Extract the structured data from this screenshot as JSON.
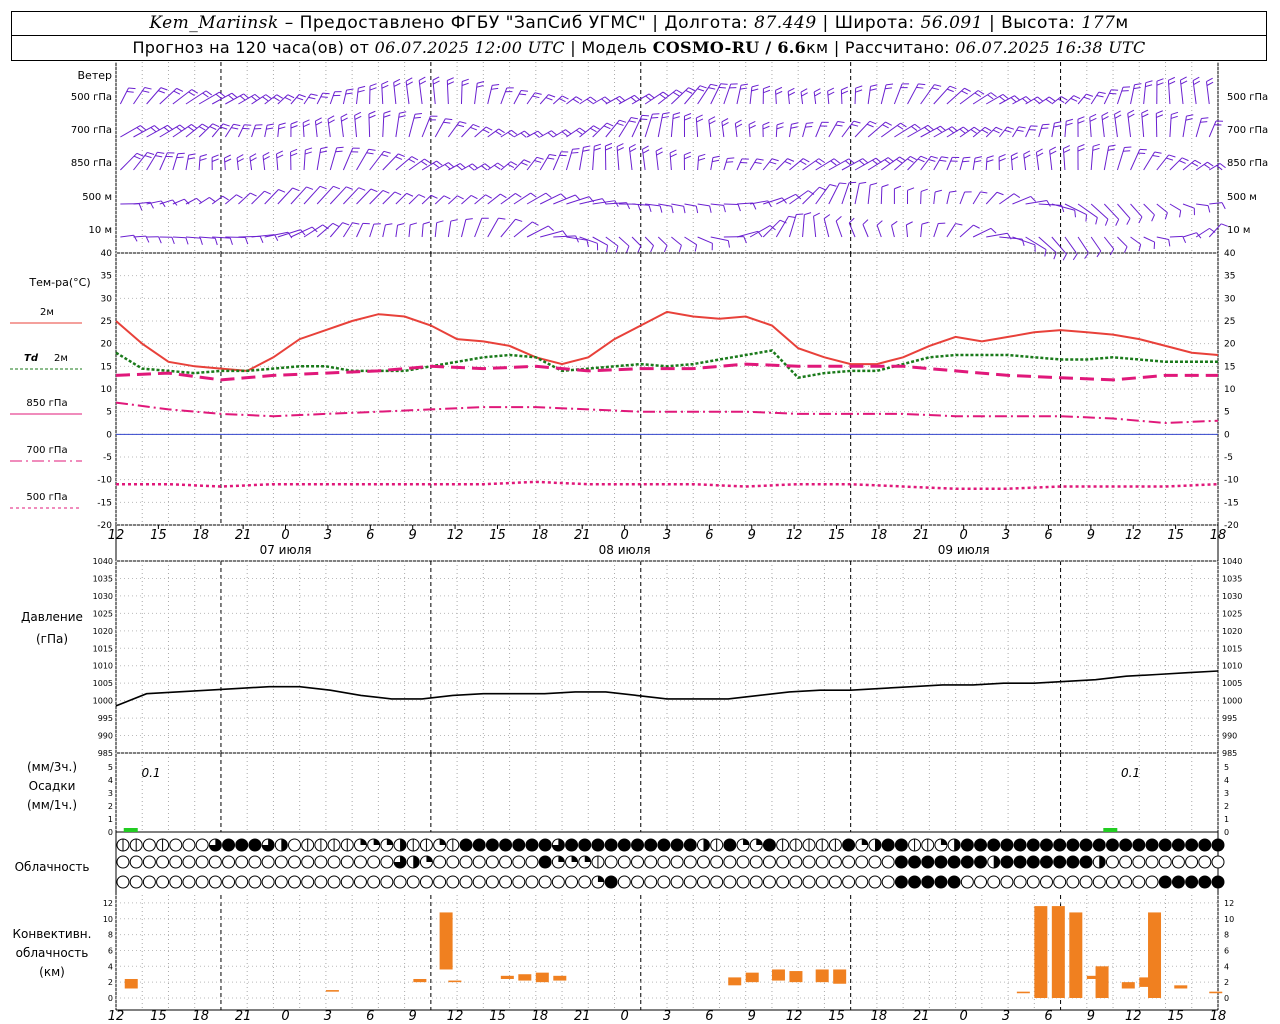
{
  "header": {
    "station": "Kem_Mariinsk",
    "provider": " – Предоставлено ФГБУ \"ЗапСиб УГМС\" | Долгота: ",
    "lon": "87.449",
    "lat_label": " | Широта: ",
    "lat": "56.091",
    "alt_label": " | Высота: ",
    "alt": "177",
    "alt_unit": "м",
    "forecast_label": "Прогноз на 120 часа(ов) от ",
    "forecast_date": "06.07.2025 12:00 UTC",
    "model_label": "  | Модель ",
    "model": "COSMO-RU / 6.6",
    "model_unit": "км",
    "calc_label": " | Рассчитано: ",
    "calc_date": "06.07.2025 16:38 UTC"
  },
  "labels": {
    "wind": "Ветер",
    "levels": [
      "500 гПа",
      "700 гПа",
      "850 гПа",
      "500 м",
      "10  м"
    ],
    "temp": "Тем-ра(°C)",
    "t2m": "2м",
    "td": "Td",
    "td2m": "2м",
    "t850": "850 гПа",
    "t700": "700 гПа",
    "t500": "500 гПа",
    "pressure": "Давление",
    "pressure_unit": "(гПа)",
    "precip_u1": "(мм/3ч.)",
    "precip": "Осадки",
    "precip_u2": "(мм/1ч.)",
    "cloud": "Облачность",
    "conv1": "Конвективн.",
    "conv2": "облачность",
    "conv3": "(км)"
  },
  "colors": {
    "t2m": "#e8413a",
    "td": "#1a7a1a",
    "t850": "#e0187a",
    "t700": "#e0187a",
    "t500": "#e0187a",
    "wind": "#6a1fd0",
    "zero": "#3344cc",
    "pressure": "#000000",
    "precip": "#22cc22",
    "conv": "#f08020"
  },
  "chart_data": {
    "type": "line",
    "time_step_hours": 3,
    "x_ticks": [
      "12",
      "15",
      "18",
      "21",
      "0",
      "3",
      "6",
      "9",
      "12",
      "15",
      "18",
      "21",
      "0",
      "3",
      "6",
      "9",
      "12",
      "15",
      "18",
      "21",
      "0",
      "3",
      "6",
      "9",
      "12",
      "15",
      "18"
    ],
    "date_labels": [
      {
        "text": "07 июля",
        "tick": 4
      },
      {
        "text": "08 июля",
        "tick": 12
      },
      {
        "text": "09 июля",
        "tick": 20
      }
    ],
    "temp_ylim": [
      -20,
      40
    ],
    "temp_yticks": [
      "40",
      "35",
      "30",
      "25",
      "20",
      "15",
      "10",
      "5",
      "0",
      "-5",
      "-10",
      "-15",
      "-20"
    ],
    "series": [
      {
        "name": "2м",
        "x": [
          0,
          3,
          6,
          9,
          12,
          15,
          18,
          21,
          24,
          27,
          30,
          33,
          36,
          39,
          42,
          45,
          48,
          51,
          54,
          57,
          60,
          63,
          66,
          69,
          72,
          75,
          78,
          81,
          84,
          87,
          90,
          93,
          96,
          99,
          102,
          105,
          108,
          111,
          114,
          117,
          120,
          123,
          126
        ],
        "values": [
          25,
          20,
          16,
          15,
          14.5,
          14,
          17,
          21,
          23,
          25,
          26.5,
          26,
          24,
          21,
          20.5,
          19.5,
          17,
          15.5,
          17,
          21,
          24,
          27,
          26,
          25.5,
          26,
          24,
          19,
          17,
          15.5,
          15.5,
          17,
          19.5,
          21.5,
          20.5,
          21.5,
          22.5,
          23,
          22.5,
          22,
          21,
          19.5,
          18,
          17.5
        ]
      },
      {
        "name": "Td 2м",
        "x": [
          0,
          3,
          6,
          9,
          12,
          15,
          18,
          21,
          24,
          27,
          30,
          33,
          36,
          39,
          42,
          45,
          48,
          51,
          54,
          57,
          60,
          63,
          66,
          69,
          72,
          75,
          78,
          81,
          84,
          87,
          90,
          93,
          96,
          99,
          102,
          105,
          108,
          111,
          114,
          117,
          120,
          123,
          126
        ],
        "values": [
          18,
          14.5,
          14,
          13.5,
          14,
          14,
          14.5,
          15,
          15,
          14,
          14,
          14,
          15,
          16,
          17,
          17.5,
          17,
          14,
          14.5,
          15,
          15.5,
          15,
          15.5,
          16.5,
          17.5,
          18.5,
          12.5,
          13.5,
          14,
          14,
          15.5,
          17,
          17.5,
          17.5,
          17.5,
          17,
          16.5,
          16.5,
          17,
          16.5,
          16,
          16,
          16
        ]
      },
      {
        "name": "850 гПа",
        "x": [
          0,
          6,
          12,
          18,
          24,
          30,
          36,
          42,
          48,
          54,
          60,
          66,
          72,
          78,
          84,
          90,
          96,
          102,
          108,
          114,
          120,
          126
        ],
        "values": [
          13,
          13.5,
          12,
          13,
          13.5,
          14,
          15,
          14.5,
          15,
          14,
          14.5,
          14.5,
          15.5,
          15,
          15,
          15,
          14,
          13,
          12.5,
          12,
          13,
          13
        ]
      },
      {
        "name": "700 гПа",
        "x": [
          0,
          6,
          12,
          18,
          24,
          30,
          36,
          42,
          48,
          54,
          60,
          66,
          72,
          78,
          84,
          90,
          96,
          102,
          108,
          114,
          120,
          126
        ],
        "values": [
          7,
          5.5,
          4.5,
          4,
          4.5,
          5,
          5.5,
          6,
          6,
          5.5,
          5,
          5,
          5,
          4.5,
          4.5,
          4.5,
          4,
          4,
          4,
          3.5,
          2.5,
          3
        ]
      },
      {
        "name": "500 гПа",
        "x": [
          0,
          6,
          12,
          18,
          24,
          30,
          36,
          42,
          48,
          54,
          60,
          66,
          72,
          78,
          84,
          90,
          96,
          102,
          108,
          114,
          120,
          126
        ],
        "values": [
          -11,
          -11,
          -11.5,
          -11,
          -11,
          -11,
          -11,
          -11,
          -10.5,
          -11,
          -11,
          -11,
          -11.5,
          -11,
          -11,
          -11.5,
          -12,
          -12,
          -11.5,
          -11.5,
          -11.5,
          -11
        ]
      }
    ],
    "pressure": {
      "ylim": [
        985,
        1040
      ],
      "yticks": [
        "1040",
        "1035",
        "1030",
        "1025",
        "1020",
        "1015",
        "1010",
        "1005",
        "1000",
        "995",
        "990",
        "985"
      ],
      "x": [
        0,
        3,
        6,
        9,
        12,
        15,
        18,
        21,
        24,
        27,
        30,
        33,
        36,
        39,
        42,
        45,
        48,
        51,
        54,
        57,
        60,
        63,
        66,
        69,
        72,
        75,
        78,
        81,
        84,
        87,
        90,
        93,
        96,
        99,
        102,
        105,
        108,
        111,
        114,
        117,
        120,
        123,
        126
      ],
      "values": [
        998.5,
        1002,
        1002.5,
        1003,
        1003.5,
        1004,
        1004,
        1003,
        1001.5,
        1000.5,
        1000.5,
        1001.5,
        1002,
        1002,
        1002,
        1002.5,
        1002.5,
        1001.5,
        1000.5,
        1000.5,
        1000.5,
        1001.5,
        1002.5,
        1003,
        1003,
        1003.5,
        1004,
        1004.5,
        1004.5,
        1005,
        1005,
        1005.5,
        1006,
        1007,
        1007.5,
        1008,
        1008.5
      ]
    },
    "precip": {
      "yticks": [
        "5",
        "4",
        "3",
        "2",
        "1",
        "0"
      ],
      "totals": [
        {
          "text": "0.1",
          "hour": 2
        },
        {
          "text": "0.1",
          "hour": 114
        }
      ],
      "bars": [
        {
          "hour": 1,
          "value": 0.1
        },
        {
          "hour": 113,
          "value": 0.1
        }
      ]
    },
    "conv_cloud": {
      "ylim": [
        0,
        13
      ],
      "yticks": [
        "12",
        "10",
        "8",
        "6",
        "4",
        "2",
        "0"
      ],
      "bars": [
        {
          "h": 1,
          "base": 1.2,
          "top": 2.4
        },
        {
          "h": 24,
          "base": 0.8,
          "top": 1.0
        },
        {
          "h": 34,
          "base": 2.0,
          "top": 2.4
        },
        {
          "h": 37,
          "base": 3.6,
          "top": 10.8
        },
        {
          "h": 38,
          "base": 2.0,
          "top": 2.2
        },
        {
          "h": 44,
          "base": 2.4,
          "top": 2.8
        },
        {
          "h": 46,
          "base": 2.2,
          "top": 3.0
        },
        {
          "h": 48,
          "base": 2.0,
          "top": 3.2
        },
        {
          "h": 50,
          "base": 2.2,
          "top": 2.8
        },
        {
          "h": 70,
          "base": 1.6,
          "top": 2.6
        },
        {
          "h": 72,
          "base": 2.0,
          "top": 3.2
        },
        {
          "h": 75,
          "base": 2.2,
          "top": 3.6
        },
        {
          "h": 77,
          "base": 2.0,
          "top": 3.4
        },
        {
          "h": 80,
          "base": 2.0,
          "top": 3.6
        },
        {
          "h": 82,
          "base": 1.8,
          "top": 3.6
        },
        {
          "h": 103,
          "base": 0.6,
          "top": 0.8
        },
        {
          "h": 105,
          "base": 0.0,
          "top": 11.6
        },
        {
          "h": 107,
          "base": 0.0,
          "top": 11.6
        },
        {
          "h": 109,
          "base": 0.0,
          "top": 10.8
        },
        {
          "h": 111,
          "base": 2.4,
          "top": 2.8
        },
        {
          "h": 112,
          "base": 0.0,
          "top": 4.0
        },
        {
          "h": 115,
          "base": 1.2,
          "top": 2.0
        },
        {
          "h": 117,
          "base": 1.4,
          "top": 2.6
        },
        {
          "h": 118,
          "base": 0.0,
          "top": 10.8
        },
        {
          "h": 121,
          "base": 1.2,
          "top": 1.6
        },
        {
          "h": 125,
          "base": 0.6,
          "top": 0.8
        }
      ]
    },
    "cloud_cover": {
      "rows": [
        "upper",
        "middle",
        "lower"
      ],
      "upper": "2202000688864022223334223288888886888888888842833822222834882234888888888888888888888888840444200000",
      "middle": "0000000000000000000006430000000083332000000000000000000000088888884888888840000000000088888888888888880000880000",
      "lower": "000000000000000000000000000000000000380000000000000000000008888800000000000000088888888888888888430088880000"
    }
  }
}
